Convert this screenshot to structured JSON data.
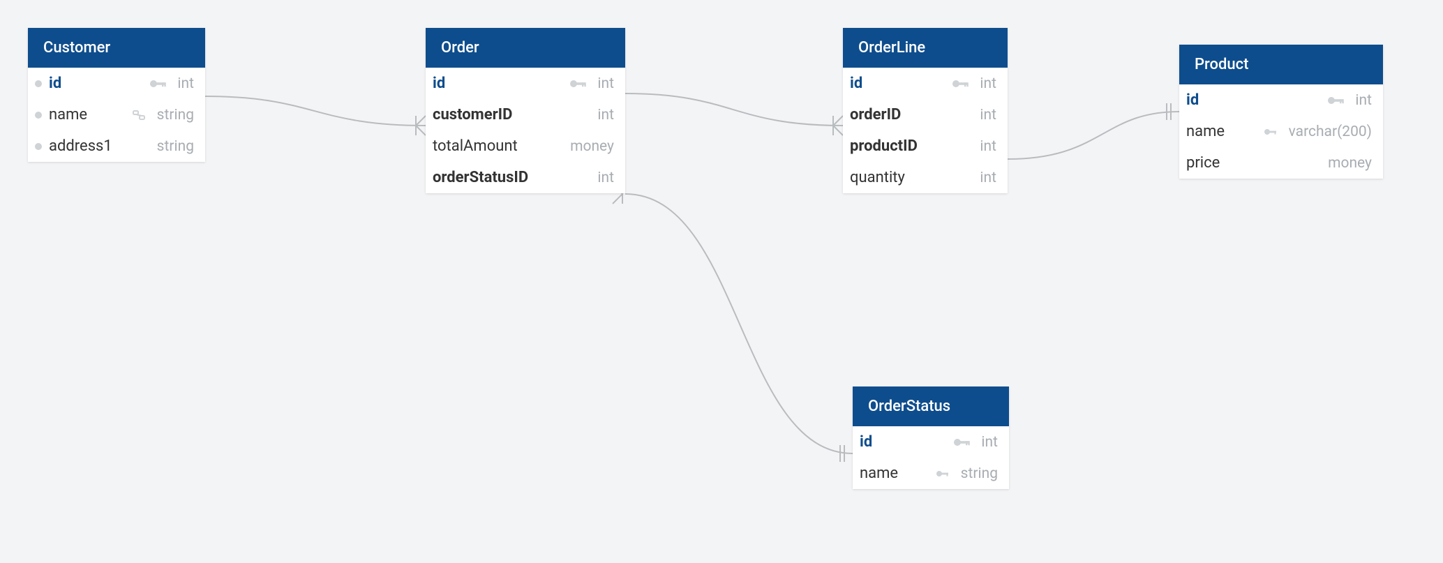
{
  "entities": {
    "customer": {
      "title": "Customer",
      "cols": [
        {
          "name": "id",
          "type": "int",
          "pk": true
        },
        {
          "name": "name",
          "type": "string",
          "fk": true
        },
        {
          "name": "address1",
          "type": "string"
        }
      ]
    },
    "order": {
      "title": "Order",
      "cols": [
        {
          "name": "id",
          "type": "int",
          "pk": true
        },
        {
          "name": "customerID",
          "type": "int",
          "bold": true
        },
        {
          "name": "totalAmount",
          "type": "money"
        },
        {
          "name": "orderStatusID",
          "type": "int",
          "bold": true
        }
      ]
    },
    "orderline": {
      "title": "OrderLine",
      "cols": [
        {
          "name": "id",
          "type": "int",
          "pk": true
        },
        {
          "name": "orderID",
          "type": "int",
          "bold": true
        },
        {
          "name": "productID",
          "type": "int",
          "bold": true
        },
        {
          "name": "quantity",
          "type": "int"
        }
      ]
    },
    "product": {
      "title": "Product",
      "cols": [
        {
          "name": "id",
          "type": "int",
          "pk": true
        },
        {
          "name": "name",
          "type": "varchar(200)",
          "fk": true
        },
        {
          "name": "price",
          "type": "money"
        }
      ]
    },
    "orderstatus": {
      "title": "OrderStatus",
      "cols": [
        {
          "name": "id",
          "type": "int",
          "pk": true
        },
        {
          "name": "name",
          "type": "string",
          "fk": true
        }
      ]
    }
  },
  "relations": [
    {
      "from": "customer.id",
      "to": "order.customerID"
    },
    {
      "from": "order.id",
      "to": "orderline.orderID"
    },
    {
      "from": "orderline.productID",
      "to": "product.id"
    },
    {
      "from": "order.orderStatusID",
      "to": "orderstatus.id"
    }
  ]
}
